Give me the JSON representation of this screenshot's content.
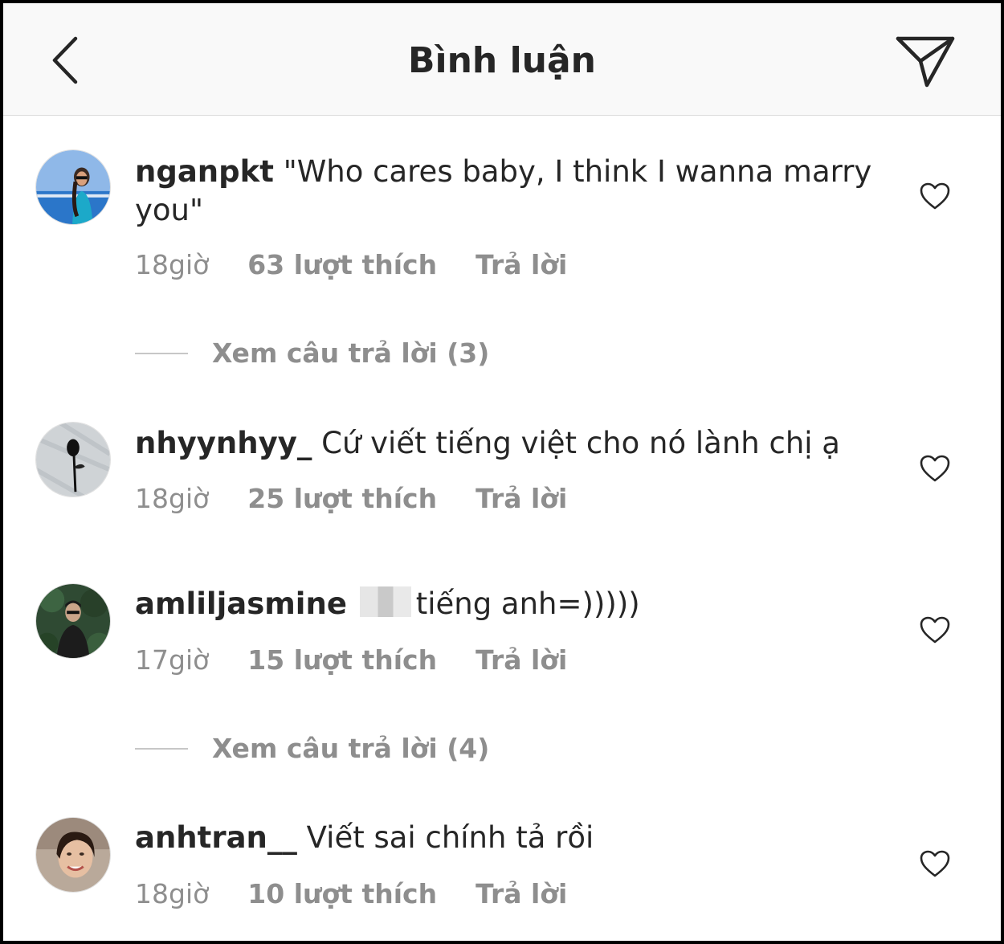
{
  "header": {
    "title": "Bình luận"
  },
  "comments": [
    {
      "username": "nganpkt",
      "text": "\"Who cares baby, I think I wanna marry you\"",
      "time": "18giờ",
      "likes": "63 lượt thích",
      "reply": "Trả lời",
      "view_replies": "Xem câu trả lời (3)"
    },
    {
      "username": "nhyynhyy_",
      "text": "Cứ viết tiếng việt cho nó lành chị ạ",
      "time": "18giờ",
      "likes": "25 lượt thích",
      "reply": "Trả lời"
    },
    {
      "username": "amliljasmine",
      "text": "tiếng anh=)))))",
      "time": "17giờ",
      "likes": "15 lượt thích",
      "reply": "Trả lời",
      "view_replies": "Xem câu trả lời (4)"
    },
    {
      "username": "anhtran__",
      "text": "Viết sai chính tả rồi",
      "time": "18giờ",
      "likes": "10 lượt thích",
      "reply": "Trả lời"
    }
  ],
  "icons": {
    "back": "chevron-left-icon",
    "send": "paper-plane-icon",
    "like": "heart-outline-icon"
  },
  "colors": {
    "text": "#262626",
    "secondary": "#8e8e8e",
    "header_bg": "#f9f9f9"
  }
}
